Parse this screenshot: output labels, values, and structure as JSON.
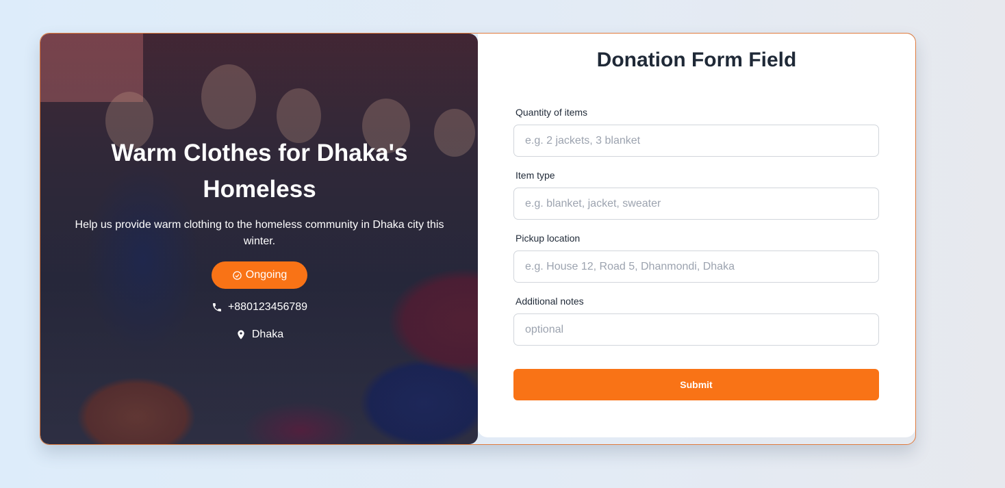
{
  "hero": {
    "title": "Warm Clothes for Dhaka's Homeless",
    "description": "Help us provide warm clothing to the homeless community in Dhaka city this winter.",
    "status": "Ongoing",
    "status_icon": "check-circle-icon",
    "phone": "+880123456789",
    "phone_icon": "phone-icon",
    "location": "Dhaka",
    "location_icon": "map-pin-icon"
  },
  "form": {
    "title": "Donation Form Field",
    "fields": [
      {
        "label": "Quantity of items",
        "placeholder": "e.g. 2 jackets, 3 blanket",
        "value": ""
      },
      {
        "label": "Item type",
        "placeholder": "e.g. blanket, jacket, sweater",
        "value": ""
      },
      {
        "label": "Pickup location",
        "placeholder": "e.g. House 12, Road 5, Dhanmondi, Dhaka",
        "value": ""
      },
      {
        "label": "Additional notes",
        "placeholder": "optional",
        "value": ""
      }
    ],
    "submit_label": "Submit"
  },
  "colors": {
    "accent": "#f97316",
    "card_border": "#e07a3c",
    "text_dark": "#1f2937"
  }
}
